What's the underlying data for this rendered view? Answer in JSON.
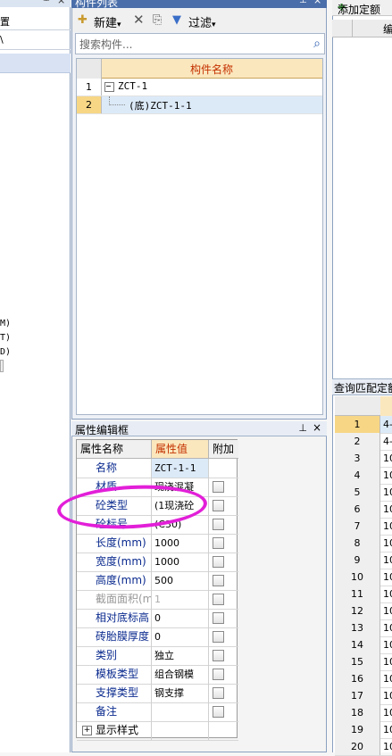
{
  "left_panel": {
    "items": [
      "置",
      "\\"
    ],
    "bottom_labels": [
      "M)",
      "T)",
      "D)"
    ]
  },
  "component_list": {
    "title": "构件列表",
    "pin": "∂",
    "close": "×",
    "toolbar": {
      "new_label": "新建",
      "filter_label": "过滤"
    },
    "search_placeholder": "搜索构件...",
    "column_header": "构件名称",
    "rows": [
      {
        "num": "1",
        "name": "ZCT-1"
      },
      {
        "num": "2",
        "name": "(底)ZCT-1-1"
      }
    ]
  },
  "property_editor": {
    "title": "属性编辑框",
    "pin": "∂",
    "close": "×",
    "headers": [
      "属性名称",
      "属性值",
      "附加"
    ],
    "rows": [
      {
        "name": "名称",
        "value": "ZCT-1-1",
        "checkbox": false
      },
      {
        "name": "材质",
        "value": "现浇混凝",
        "checkbox": true
      },
      {
        "name": "砼类型",
        "value": "(1现浇砼",
        "checkbox": true
      },
      {
        "name": "砼标号",
        "value": "(C30)",
        "checkbox": true
      },
      {
        "name": "长度(mm)",
        "value": "1000",
        "checkbox": true
      },
      {
        "name": "宽度(mm)",
        "value": "1000",
        "checkbox": true
      },
      {
        "name": "高度(mm)",
        "value": "500",
        "checkbox": true
      },
      {
        "name": "截面面积(m",
        "value": "1",
        "checkbox": true,
        "disabled": true
      },
      {
        "name": "相对底标高",
        "value": "0",
        "checkbox": true
      },
      {
        "name": "砖胎膜厚度",
        "value": "0",
        "checkbox": true
      },
      {
        "name": "类别",
        "value": "独立",
        "checkbox": true
      },
      {
        "name": "模板类型",
        "value": "组合钢模",
        "checkbox": true
      },
      {
        "name": "支撑类型",
        "value": "钢支撑",
        "checkbox": true
      },
      {
        "name": "备注",
        "value": "",
        "checkbox": true
      }
    ],
    "expand_row": "显示样式"
  },
  "right_panel": {
    "add_quota_label": "添加定额",
    "header_col": "编",
    "query_title": "查询匹配定额",
    "rows": [
      {
        "num": "1",
        "val": "4-"
      },
      {
        "num": "2",
        "val": "4-"
      },
      {
        "num": "3",
        "val": "10"
      },
      {
        "num": "4",
        "val": "10"
      },
      {
        "num": "5",
        "val": "10"
      },
      {
        "num": "6",
        "val": "10"
      },
      {
        "num": "7",
        "val": "10"
      },
      {
        "num": "8",
        "val": "10"
      },
      {
        "num": "9",
        "val": "10"
      },
      {
        "num": "10",
        "val": "10"
      },
      {
        "num": "11",
        "val": "10"
      },
      {
        "num": "12",
        "val": "10"
      },
      {
        "num": "13",
        "val": "10"
      },
      {
        "num": "14",
        "val": "10"
      },
      {
        "num": "15",
        "val": "10"
      },
      {
        "num": "16",
        "val": "10"
      },
      {
        "num": "17",
        "val": "10"
      },
      {
        "num": "18",
        "val": "10"
      },
      {
        "num": "19",
        "val": "10"
      },
      {
        "num": "20",
        "val": "10"
      }
    ]
  },
  "colors": {
    "annotation": "#e21fd8",
    "header_bg": "#fbe7bd",
    "selected_row": "#dceaf8"
  }
}
